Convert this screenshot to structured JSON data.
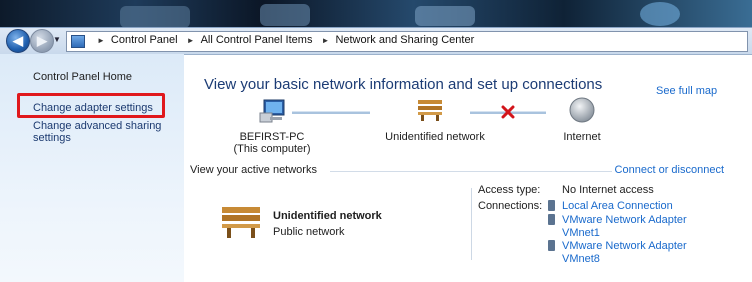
{
  "breadcrumb": [
    "Control Panel",
    "All Control Panel Items",
    "Network and Sharing Center"
  ],
  "sidebar": {
    "home": "Control Panel Home",
    "adapter": "Change adapter settings",
    "advanced_line1": "Change advanced sharing",
    "advanced_line2": "settings"
  },
  "main": {
    "heading": "View your basic network information and set up connections",
    "see_full_map": "See full map",
    "map": {
      "computer_name": "BEFIRST-PC",
      "computer_sub": "(This computer)",
      "network": "Unidentified network",
      "internet": "Internet"
    },
    "active_title": "View your active networks",
    "connect_link": "Connect or disconnect",
    "network_name": "Unidentified network",
    "network_type": "Public network",
    "access_label": "Access type:",
    "access_value": "No Internet access",
    "connections_label": "Connections:",
    "connections": [
      {
        "line1": "Local Area Connection",
        "line2": ""
      },
      {
        "line1": "VMware Network Adapter",
        "line2": "VMnet1"
      },
      {
        "line1": "VMware Network Adapter",
        "line2": "VMnet8"
      }
    ]
  },
  "colors": {
    "highlight": "#e0181c",
    "link": "#1a6acc",
    "heading": "#1c3c75",
    "error": "#d2151b"
  }
}
